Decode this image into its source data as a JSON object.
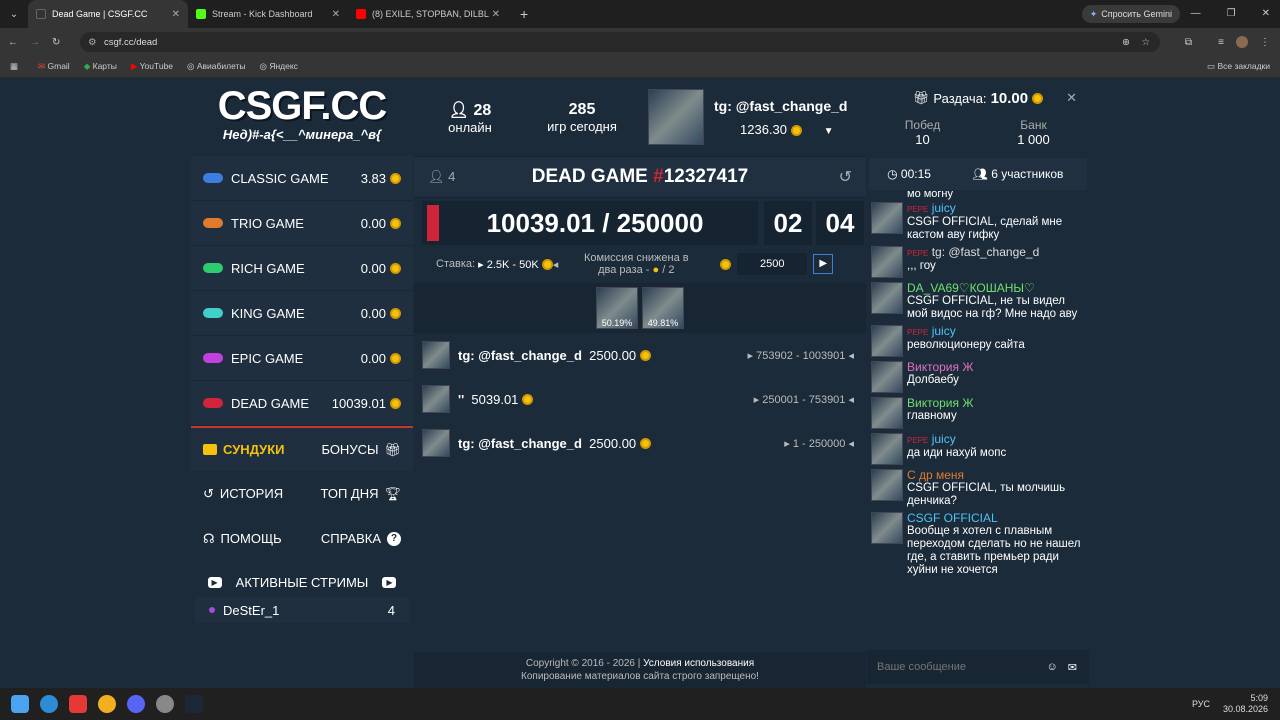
{
  "browser": {
    "tabs": [
      {
        "title": "Dead Game | CSGF.CC",
        "active": true,
        "color": "#333"
      },
      {
        "title": "Stream - Kick Dashboard",
        "active": false,
        "color": "#53fc18"
      },
      {
        "title": "(8) EXILE, STOPBAN, DILBL",
        "active": false,
        "color": "#ff0000"
      }
    ],
    "url": "csgf.cc/dead",
    "gemini": "Спросить Gemini",
    "bookmarks": [
      "Gmail",
      "Карты",
      "YouTube",
      "Авиабилеты",
      "Яндекс"
    ],
    "all_bookmarks": "Все закладки"
  },
  "logo": {
    "title": "CSGF.CC",
    "subtitle": "Нед)#-а{<__^минера_^в{"
  },
  "games": [
    {
      "name": "CLASSIC GAME",
      "value": "3.83",
      "color": "#3b7de0"
    },
    {
      "name": "TRIO GAME",
      "value": "0.00",
      "color": "#e07b2e"
    },
    {
      "name": "RICH GAME",
      "value": "0.00",
      "color": "#2ecc71"
    },
    {
      "name": "KING GAME",
      "value": "0.00",
      "color": "#3fd0c8"
    },
    {
      "name": "EPIC GAME",
      "value": "0.00",
      "color": "#c040e0"
    },
    {
      "name": "DEAD GAME",
      "value": "10039.01",
      "color": "#d0243a"
    }
  ],
  "menu": {
    "chests": "СУНДУКИ",
    "bonuses": "БОНУСЫ",
    "history": "ИСТОРИЯ",
    "top": "ТОП ДНЯ",
    "help": "ПОМОЩЬ",
    "info": "СПРАВКА",
    "streams": "АКТИВНЫЕ СТРИМЫ",
    "streamer": {
      "name": "DeStEr_1",
      "count": "4"
    }
  },
  "stats": {
    "online": "28",
    "online_label": "онлайн",
    "games_today": "285",
    "games_label": "игр сегодня"
  },
  "user": {
    "name": "tg: @fast_change_d",
    "balance": "1236.30"
  },
  "game": {
    "players_icon_count": "4",
    "title": "DEAD GAME",
    "hash": "#",
    "number": "12327417",
    "bank": "10039.01 / 250000",
    "timer_min": "02",
    "timer_sec": "04",
    "bet_label": "Ставка:",
    "bet_range": "2.5K - 50K",
    "commission": "Комиссия снижена в два раза -",
    "commission_frac": "/ 2",
    "bet_input": "2500",
    "chance1": "50.19%",
    "chance2": "49.81%"
  },
  "bets": [
    {
      "name": "tg: @fast_change_d",
      "amount": "2500.00",
      "tickets": "753902 - 1003901"
    },
    {
      "name": "''",
      "amount": "5039.01",
      "tickets": "250001 - 753901"
    },
    {
      "name": "tg: @fast_change_d",
      "amount": "2500.00",
      "tickets": "1 - 250000"
    }
  ],
  "footer": {
    "line1": "Copyright © 2016 - 2026 |",
    "terms": "Условия использования",
    "line2": "Копирование материалов сайта строго запрещено!"
  },
  "giveaway": {
    "label": "Раздача:",
    "amount": "10.00",
    "wins_label": "Побед",
    "wins": "10",
    "bank_label": "Банк",
    "bank": "1 000",
    "timer": "00:15",
    "participants": "6 участников"
  },
  "chat": {
    "partial": "мо могну",
    "messages": [
      {
        "tag": "PEPE",
        "name": "juicy",
        "name_color": "#4fc3f7",
        "text": "CSGF OFFICIAL, сделай мне кастом аву гифку"
      },
      {
        "tag": "PEPE",
        "name": "tg: @fast_change_d",
        "name_color": "#dddddd",
        "text": ",,, гоу"
      },
      {
        "tag": "",
        "name": "DA_VA69♡КОШАНЫ♡",
        "name_color": "#6fe06f",
        "text": "CSGF OFFICIAL, не ты видел мой видос на гф? Мне надо аву"
      },
      {
        "tag": "PEPE",
        "name": "juicy",
        "name_color": "#4fc3f7",
        "text": "революционеру сайта"
      },
      {
        "tag": "",
        "name": "Виктория Ж",
        "name_color": "#e070c0",
        "text": "Долбаебу"
      },
      {
        "tag": "",
        "name": "Виктория Ж",
        "name_color": "#6fe06f",
        "text": "главному"
      },
      {
        "tag": "PEPE",
        "name": "juicy",
        "name_color": "#4fc3f7",
        "text": "да иди нахуй мопс"
      },
      {
        "tag": "",
        "name": "С др меня",
        "name_color": "#e07b2e",
        "text": "CSGF OFFICIAL, ты молчишь денчика?"
      },
      {
        "tag": "",
        "name": "CSGF OFFICIAL",
        "name_color": "#4fc3f7",
        "text": "Вообще я хотел с плавным переходом сделать но не нашел где, а ставить премьер ради хуйни не хочется"
      }
    ],
    "placeholder": "Ваше сообщение"
  },
  "taskbar": {
    "lang": "РУС",
    "time": "5:09",
    "date": "30.08.2026"
  }
}
